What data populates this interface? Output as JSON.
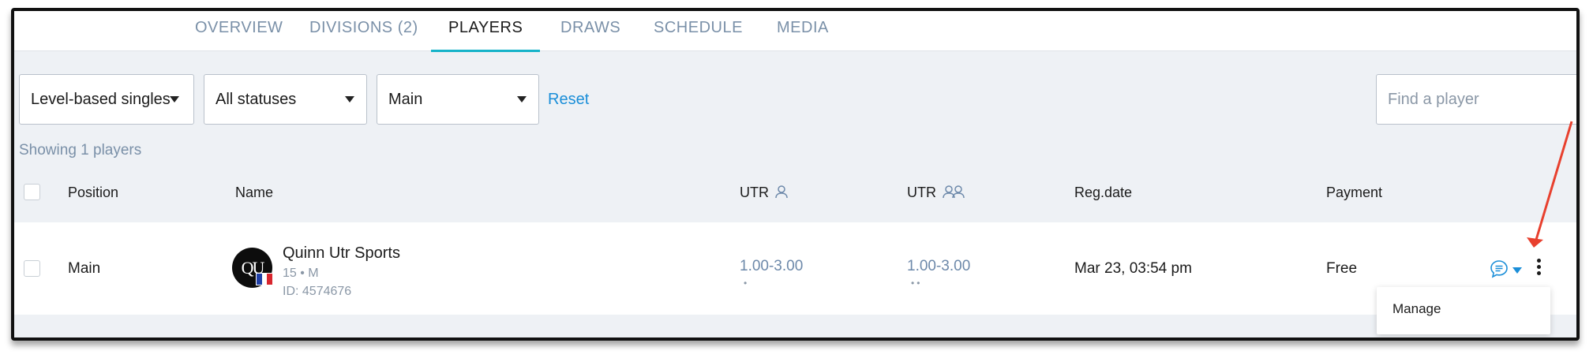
{
  "tabs": [
    {
      "label": "OVERVIEW"
    },
    {
      "label": "DIVISIONS (2)"
    },
    {
      "label": "PLAYERS",
      "active": true
    },
    {
      "label": "DRAWS"
    },
    {
      "label": "SCHEDULE"
    },
    {
      "label": "MEDIA"
    }
  ],
  "filters": {
    "event_type": "Level-based singles",
    "status": "All statuses",
    "draw": "Main",
    "reset_label": "Reset",
    "search_placeholder": "Find a player"
  },
  "showing_text": "Showing 1 players",
  "table": {
    "headers": {
      "position": "Position",
      "name": "Name",
      "utr_singles": "UTR",
      "utr_doubles": "UTR",
      "reg_date": "Reg.date",
      "payment": "Payment"
    },
    "rows": [
      {
        "position": "Main",
        "avatar_initials": "QU",
        "name": "Quinn Utr Sports",
        "age_gender": "15 • M",
        "id": "ID: 4574676",
        "utr_singles": "1.00-3.00",
        "utr_singles_dots": "•",
        "utr_doubles": "1.00-3.00",
        "utr_doubles_dots": "••",
        "reg_date": "Mar 23, 03:54 pm",
        "payment": "Free"
      }
    ]
  },
  "row_menu": {
    "items": [
      {
        "label": "Manage"
      }
    ]
  },
  "icons": {
    "single_player": "person-icon",
    "doubles": "two-persons-icon",
    "message": "chat-bubble-icon",
    "more": "kebab-menu-icon",
    "annotation": "red-arrow-annotation"
  },
  "colors": {
    "accent": "#16b3c9",
    "link": "#1a8ed8",
    "annotation": "#e8402e"
  }
}
